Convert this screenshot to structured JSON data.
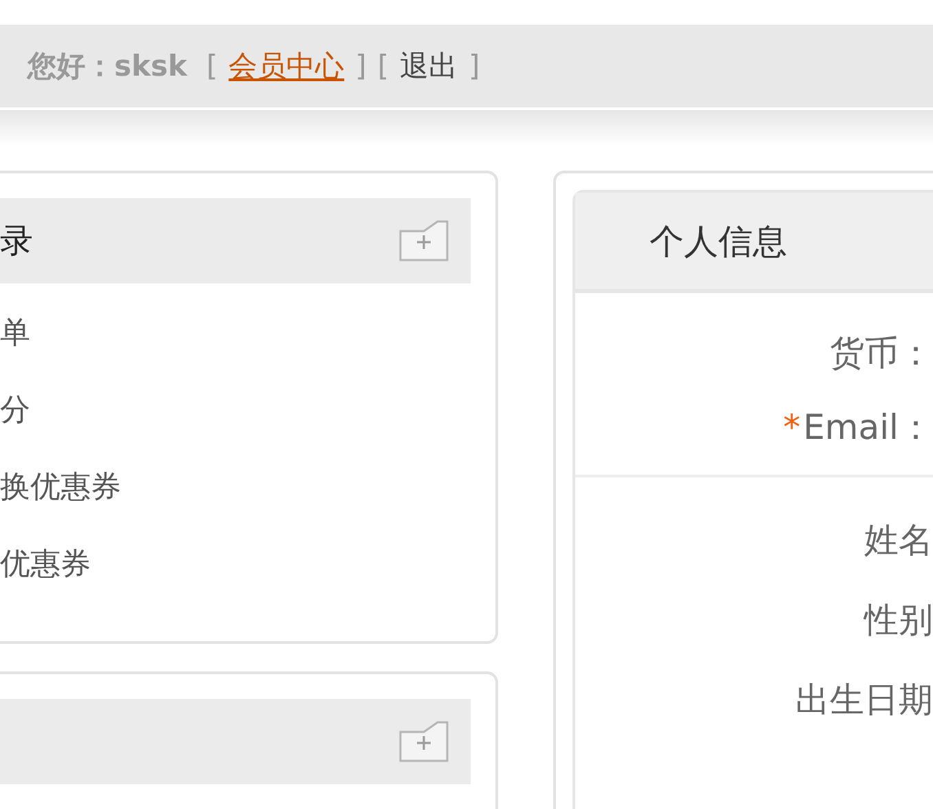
{
  "top_bar": {
    "greeting": "您好：sksk",
    "links": [
      {
        "open": "[",
        "label": "会员中心",
        "close": "]",
        "selected": true
      },
      {
        "open": "[",
        "label": "退出",
        "close": "]",
        "selected": false
      }
    ]
  },
  "left_cards": [
    {
      "kind": "card",
      "title": "录",
      "items": [
        "单",
        "分",
        "换优惠券",
        "优惠券"
      ]
    },
    {
      "kind": "card"
    }
  ],
  "profile": {
    "title": "个人信息",
    "sections": [
      [
        {
          "label": "货币："
        },
        {
          "mark": "*",
          "label": "Email："
        }
      ],
      [
        {
          "label": "姓名"
        },
        {
          "label": "性别"
        },
        {
          "label": "出生日期"
        }
      ]
    ]
  }
}
